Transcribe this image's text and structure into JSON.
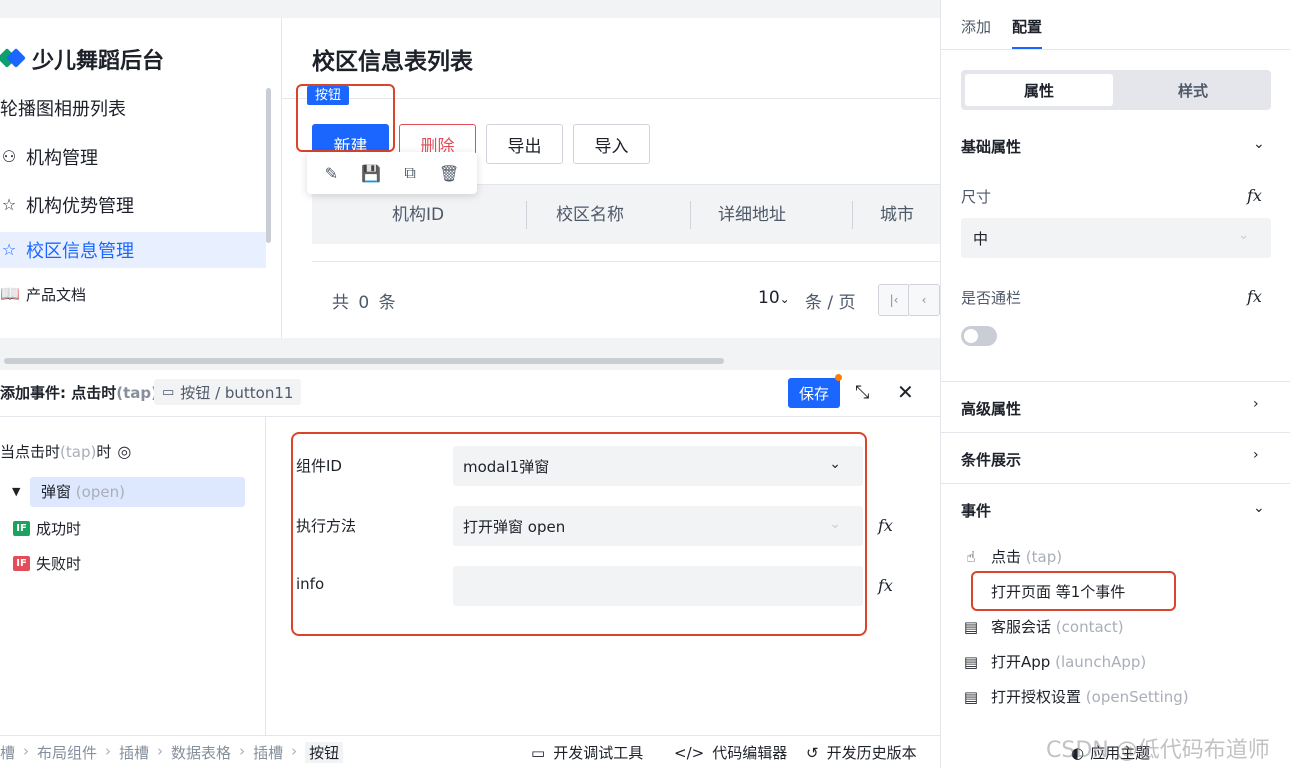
{
  "preview": {
    "brand": "少儿舞蹈后台",
    "nav": [
      {
        "label": "轮播图相册列表",
        "icon": "none"
      },
      {
        "label": "机构管理",
        "icon": "user-icon"
      },
      {
        "label": "机构优势管理",
        "icon": "star-icon"
      },
      {
        "label": "校区信息管理",
        "icon": "star-icon",
        "active": true
      },
      {
        "label": "产品文档",
        "icon": "book-icon"
      }
    ],
    "page_title": "校区信息表列表",
    "selected_tag": "按钮",
    "buttons": {
      "new": "新建",
      "delete": "删除",
      "export": "导出",
      "import": "导入"
    },
    "table_headers": [
      "机构ID",
      "校区名称",
      "详细地址",
      "城市"
    ],
    "pagination": {
      "total": "共 0 条",
      "page_size": "10",
      "per_page": "条 / 页"
    }
  },
  "event_editor": {
    "title_prefix": "添加事件: 点击时",
    "title_hint": "(tap)",
    "chip": "按钮 / button11",
    "save": "保存",
    "trigger_label": "当点击时",
    "trigger_hint": "(tap)",
    "trigger_suffix": "时",
    "action_label": "弹窗",
    "action_hint": "(open)",
    "success": "成功时",
    "fail": "失败时",
    "if_badge": "IF",
    "form": {
      "component_id_label": "组件ID",
      "component_id_value": "modal1弹窗",
      "method_label": "执行方法",
      "method_value": "打开弹窗 open",
      "info_label": "info",
      "info_value": ""
    }
  },
  "bottom_bar": {
    "crumbs": [
      "槽",
      "布局组件",
      "插槽",
      "数据表格",
      "插槽",
      "按钮"
    ],
    "tools": [
      "开发调试工具",
      "代码编辑器",
      "开发历史版本"
    ]
  },
  "right_panel": {
    "tabs": [
      "添加",
      "配置"
    ],
    "segments": [
      "属性",
      "样式"
    ],
    "basic_props": "基础属性",
    "size_label": "尺寸",
    "size_value": "中",
    "fullwidth_label": "是否通栏",
    "fullwidth_on": false,
    "advanced": "高级属性",
    "conditional": "条件展示",
    "events": "事件",
    "event_items": [
      {
        "label": "点击",
        "hint": "(tap)"
      },
      {
        "label": "客服会话",
        "hint": "(contact)"
      },
      {
        "label": "打开App",
        "hint": "(launchApp)"
      },
      {
        "label": "打开授权设置",
        "hint": "(openSetting)"
      }
    ],
    "linked_events": "打开页面 等1个事件",
    "theme": "应用主题"
  },
  "watermark": "CSDN @低代码布道师",
  "colors": {
    "primary": "#1a66ff",
    "danger": "#e34d59",
    "highlight": "#d9442a"
  }
}
